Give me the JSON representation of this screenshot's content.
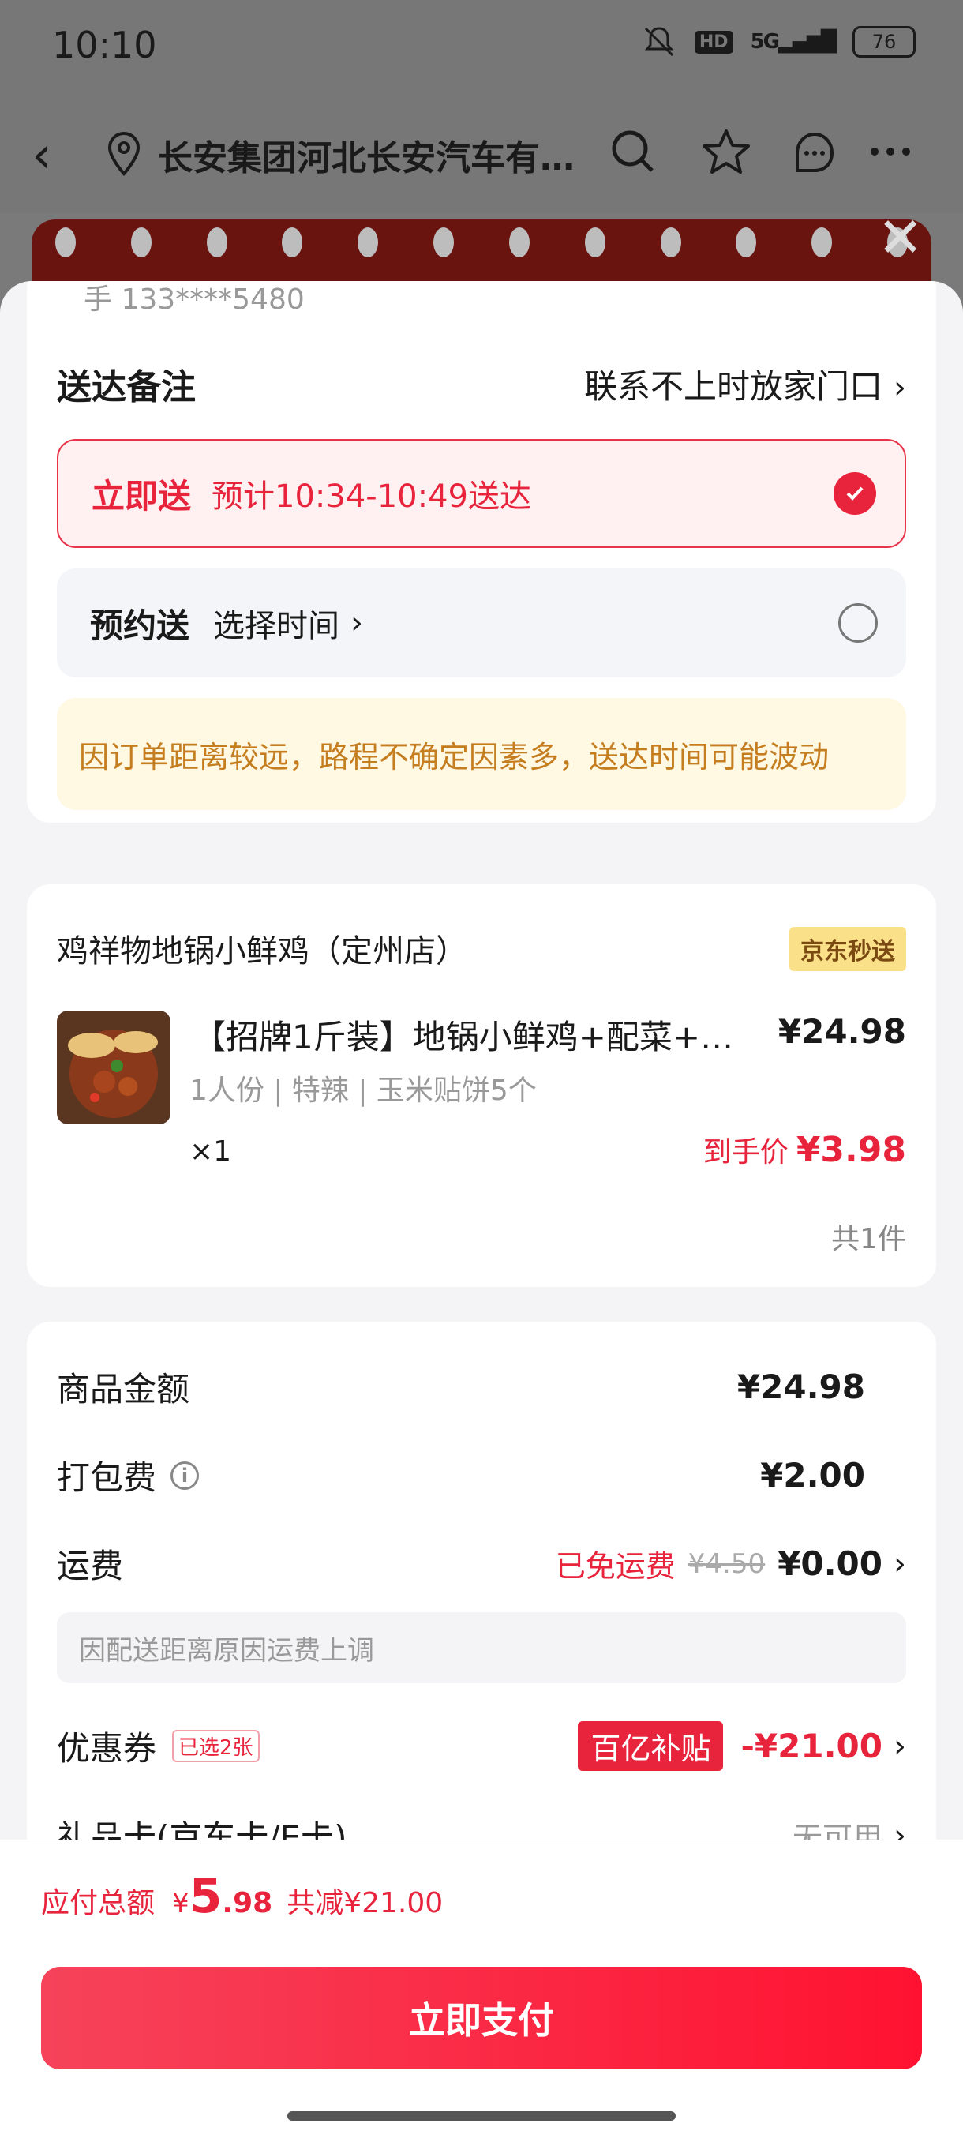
{
  "status_bar": {
    "time": "10:10",
    "hd": "HD",
    "network": "5G",
    "battery": "76"
  },
  "nav": {
    "title": "长安集团河北长安汽车有…"
  },
  "delivery": {
    "phone_cut": "手 133****5480",
    "remark_label": "送达备注",
    "remark_value": "联系不上时放家门口",
    "now_label": "立即送",
    "now_eta": "预计10:34-10:49送达",
    "schedule_label": "预约送",
    "schedule_sub": "选择时间",
    "notice": "因订单距离较远，路程不确定因素多，送达时间可能波动"
  },
  "store": {
    "name": "鸡祥物地锅小鲜鸡（定州店）",
    "badge": "京东秒送",
    "product_name": "【招牌1斤装】地锅小鲜鸡+配菜+…",
    "product_price": "¥24.98",
    "spec": "1人份 | 特辣 | 玉米贴饼5个",
    "qty": "×1",
    "final_label": "到手价",
    "final_price": "¥3.98",
    "count": "共1件"
  },
  "fees": {
    "goods_label": "商品金额",
    "goods_amt": "¥24.98",
    "pack_label": "打包费",
    "pack_amt": "¥2.00",
    "ship_label": "运费",
    "ship_free": "已免运费",
    "ship_orig": "¥4.50",
    "ship_amt": "¥0.00",
    "ship_note": "因配送距离原因运费上调",
    "coupon_label": "优惠券",
    "coupon_tag": "已选2张",
    "subsidy": "百亿补贴",
    "coupon_amt": "-¥21.00",
    "gift_label": "礼品卡(京东卡/E卡)",
    "gift_value": "无可用"
  },
  "footer": {
    "total_label": "应付总额",
    "currency": "¥",
    "total_int": "5",
    "total_dec": ".98",
    "saved": "共减¥21.00",
    "pay_button": "立即支付"
  },
  "colors": {
    "accent": "#e8233c",
    "notice_text": "#c47d1f",
    "badge_bg": "#fbe08a"
  }
}
